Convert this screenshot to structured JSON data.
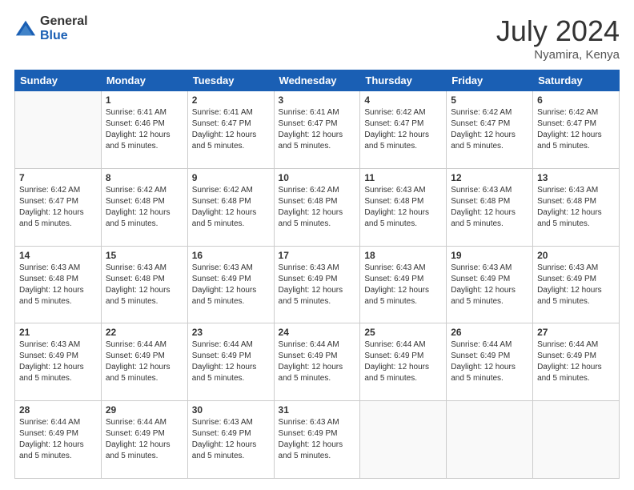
{
  "logo": {
    "general": "General",
    "blue": "Blue"
  },
  "header": {
    "title": "July 2024",
    "subtitle": "Nyamira, Kenya"
  },
  "weekdays": [
    "Sunday",
    "Monday",
    "Tuesday",
    "Wednesday",
    "Thursday",
    "Friday",
    "Saturday"
  ],
  "weeks": [
    [
      {
        "day": "",
        "info": ""
      },
      {
        "day": "1",
        "info": "Sunrise: 6:41 AM\nSunset: 6:46 PM\nDaylight: 12 hours\nand 5 minutes."
      },
      {
        "day": "2",
        "info": "Sunrise: 6:41 AM\nSunset: 6:47 PM\nDaylight: 12 hours\nand 5 minutes."
      },
      {
        "day": "3",
        "info": "Sunrise: 6:41 AM\nSunset: 6:47 PM\nDaylight: 12 hours\nand 5 minutes."
      },
      {
        "day": "4",
        "info": "Sunrise: 6:42 AM\nSunset: 6:47 PM\nDaylight: 12 hours\nand 5 minutes."
      },
      {
        "day": "5",
        "info": "Sunrise: 6:42 AM\nSunset: 6:47 PM\nDaylight: 12 hours\nand 5 minutes."
      },
      {
        "day": "6",
        "info": "Sunrise: 6:42 AM\nSunset: 6:47 PM\nDaylight: 12 hours\nand 5 minutes."
      }
    ],
    [
      {
        "day": "7",
        "info": "Sunrise: 6:42 AM\nSunset: 6:47 PM\nDaylight: 12 hours\nand 5 minutes."
      },
      {
        "day": "8",
        "info": "Sunrise: 6:42 AM\nSunset: 6:48 PM\nDaylight: 12 hours\nand 5 minutes."
      },
      {
        "day": "9",
        "info": "Sunrise: 6:42 AM\nSunset: 6:48 PM\nDaylight: 12 hours\nand 5 minutes."
      },
      {
        "day": "10",
        "info": "Sunrise: 6:42 AM\nSunset: 6:48 PM\nDaylight: 12 hours\nand 5 minutes."
      },
      {
        "day": "11",
        "info": "Sunrise: 6:43 AM\nSunset: 6:48 PM\nDaylight: 12 hours\nand 5 minutes."
      },
      {
        "day": "12",
        "info": "Sunrise: 6:43 AM\nSunset: 6:48 PM\nDaylight: 12 hours\nand 5 minutes."
      },
      {
        "day": "13",
        "info": "Sunrise: 6:43 AM\nSunset: 6:48 PM\nDaylight: 12 hours\nand 5 minutes."
      }
    ],
    [
      {
        "day": "14",
        "info": "Sunrise: 6:43 AM\nSunset: 6:48 PM\nDaylight: 12 hours\nand 5 minutes."
      },
      {
        "day": "15",
        "info": "Sunrise: 6:43 AM\nSunset: 6:48 PM\nDaylight: 12 hours\nand 5 minutes."
      },
      {
        "day": "16",
        "info": "Sunrise: 6:43 AM\nSunset: 6:49 PM\nDaylight: 12 hours\nand 5 minutes."
      },
      {
        "day": "17",
        "info": "Sunrise: 6:43 AM\nSunset: 6:49 PM\nDaylight: 12 hours\nand 5 minutes."
      },
      {
        "day": "18",
        "info": "Sunrise: 6:43 AM\nSunset: 6:49 PM\nDaylight: 12 hours\nand 5 minutes."
      },
      {
        "day": "19",
        "info": "Sunrise: 6:43 AM\nSunset: 6:49 PM\nDaylight: 12 hours\nand 5 minutes."
      },
      {
        "day": "20",
        "info": "Sunrise: 6:43 AM\nSunset: 6:49 PM\nDaylight: 12 hours\nand 5 minutes."
      }
    ],
    [
      {
        "day": "21",
        "info": "Sunrise: 6:43 AM\nSunset: 6:49 PM\nDaylight: 12 hours\nand 5 minutes."
      },
      {
        "day": "22",
        "info": "Sunrise: 6:44 AM\nSunset: 6:49 PM\nDaylight: 12 hours\nand 5 minutes."
      },
      {
        "day": "23",
        "info": "Sunrise: 6:44 AM\nSunset: 6:49 PM\nDaylight: 12 hours\nand 5 minutes."
      },
      {
        "day": "24",
        "info": "Sunrise: 6:44 AM\nSunset: 6:49 PM\nDaylight: 12 hours\nand 5 minutes."
      },
      {
        "day": "25",
        "info": "Sunrise: 6:44 AM\nSunset: 6:49 PM\nDaylight: 12 hours\nand 5 minutes."
      },
      {
        "day": "26",
        "info": "Sunrise: 6:44 AM\nSunset: 6:49 PM\nDaylight: 12 hours\nand 5 minutes."
      },
      {
        "day": "27",
        "info": "Sunrise: 6:44 AM\nSunset: 6:49 PM\nDaylight: 12 hours\nand 5 minutes."
      }
    ],
    [
      {
        "day": "28",
        "info": "Sunrise: 6:44 AM\nSunset: 6:49 PM\nDaylight: 12 hours\nand 5 minutes."
      },
      {
        "day": "29",
        "info": "Sunrise: 6:44 AM\nSunset: 6:49 PM\nDaylight: 12 hours\nand 5 minutes."
      },
      {
        "day": "30",
        "info": "Sunrise: 6:43 AM\nSunset: 6:49 PM\nDaylight: 12 hours\nand 5 minutes."
      },
      {
        "day": "31",
        "info": "Sunrise: 6:43 AM\nSunset: 6:49 PM\nDaylight: 12 hours\nand 5 minutes."
      },
      {
        "day": "",
        "info": ""
      },
      {
        "day": "",
        "info": ""
      },
      {
        "day": "",
        "info": ""
      }
    ]
  ]
}
